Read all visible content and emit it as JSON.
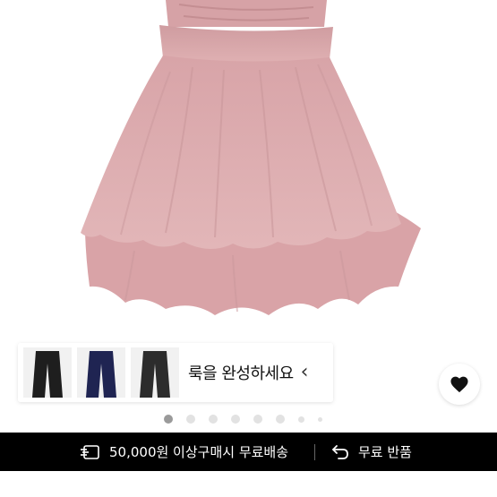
{
  "banner": {
    "text": "룩을 완성하세요",
    "chevron": "chevron-left-icon",
    "thumbnails": [
      {
        "name": "black-wide-pants",
        "color": "#1e1e1e"
      },
      {
        "name": "navy-wide-pants",
        "color": "#1f2452"
      },
      {
        "name": "charcoal-wide-pants",
        "color": "#2c2c2c"
      }
    ]
  },
  "wishlist": {
    "icon": "heart-icon"
  },
  "pager": {
    "total": 8,
    "active": 0
  },
  "benefits": {
    "shipping_icon": "shipping-truck-icon",
    "shipping_text": "50,000원 이상구매시 무료배송",
    "return_icon": "return-arrow-icon",
    "return_text": "무료 반품"
  },
  "colors": {
    "skirt": "#d9a8ab",
    "bar_bg": "#000000"
  }
}
